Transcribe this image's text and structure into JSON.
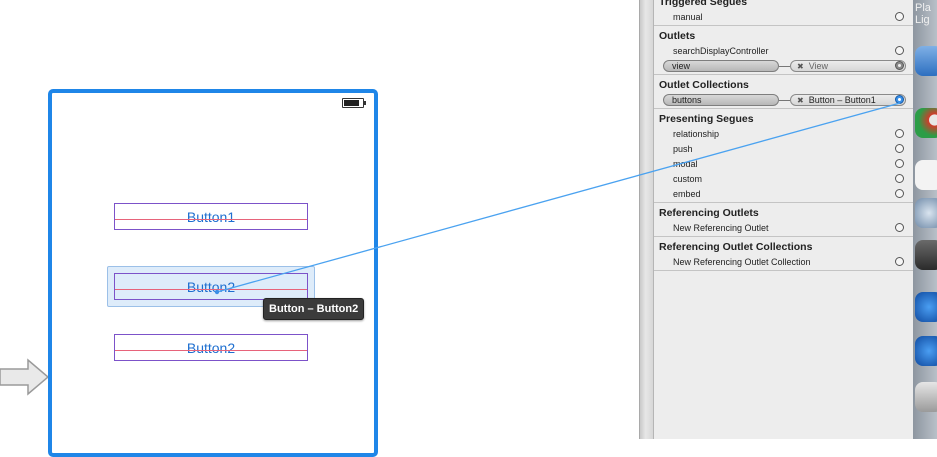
{
  "canvas": {
    "buttons": [
      {
        "label": "Button1"
      },
      {
        "label": "Button2"
      },
      {
        "label": "Button2"
      }
    ],
    "drag_tooltip": "Button – Button2"
  },
  "inspector": {
    "triggered_segues": {
      "title": "Triggered Segues",
      "rows": [
        {
          "label": "manual"
        }
      ]
    },
    "outlets": {
      "title": "Outlets",
      "rows": [
        {
          "label": "searchDisplayController"
        }
      ],
      "connection": {
        "name": "view",
        "target": "View"
      }
    },
    "outlet_collections": {
      "title": "Outlet Collections",
      "connection": {
        "name": "buttons",
        "target": "Button – Button1"
      }
    },
    "presenting_segues": {
      "title": "Presenting Segues",
      "rows": [
        {
          "label": "relationship"
        },
        {
          "label": "push"
        },
        {
          "label": "modal"
        },
        {
          "label": "custom"
        },
        {
          "label": "embed"
        }
      ]
    },
    "referencing_outlets": {
      "title": "Referencing Outlets",
      "rows": [
        {
          "label": "New Referencing Outlet"
        }
      ]
    },
    "referencing_outlet_collections": {
      "title": "Referencing Outlet Collections",
      "rows": [
        {
          "label": "New Referencing Outlet Collection"
        }
      ]
    }
  },
  "dock": {
    "partial_text": "Pla\nLig"
  },
  "colors": {
    "device_border": "#1f86e8",
    "button_text": "#1e6fd0",
    "button_outline": "#7c52c9",
    "connection_line": "#4aa2f0"
  },
  "icons": [
    "battery-icon",
    "entry-arrow-icon",
    "disconnect-x-icon",
    "connection-circle-icon"
  ]
}
